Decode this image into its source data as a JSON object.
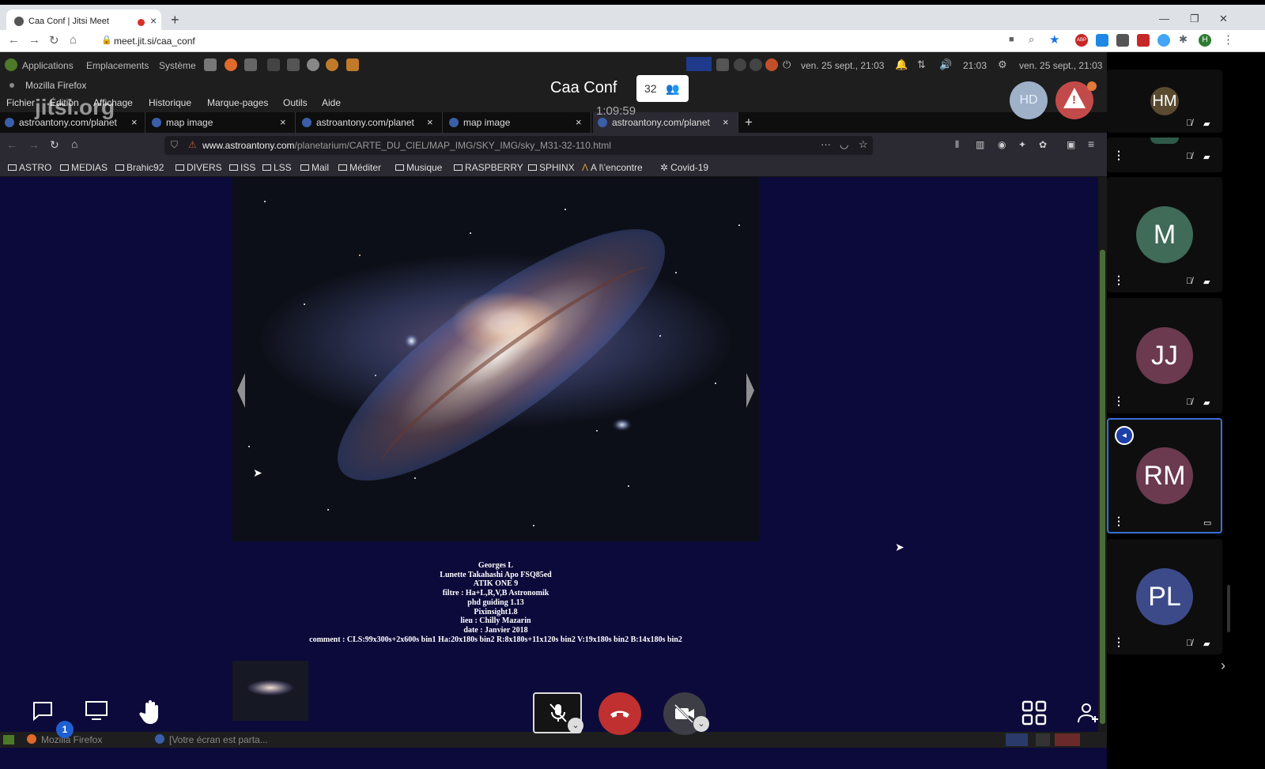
{
  "chrome": {
    "tab_title": "Caa Conf | Jitsi Meet",
    "url": "meet.jit.si/caa_conf",
    "profile_initial": "H",
    "abp_badge": "ABP"
  },
  "desktop": {
    "menus": [
      "Applications",
      "Emplacements",
      "Système"
    ],
    "clock_left": "ven. 25 sept., 21:03",
    "clock_time": "21:03",
    "clock_right": "ven. 25 sept., 21:03"
  },
  "firefox": {
    "window_title": "Mozilla Firefox",
    "menu": [
      "Fichier",
      "Édition",
      "Affichage",
      "Historique",
      "Marque-pages",
      "Outils",
      "Aide"
    ],
    "tabs": [
      "astroantony.com/planet",
      "map image",
      "astroantony.com/planet",
      "map image",
      "astroantony.com/planet"
    ],
    "url_host": "www.astroantony.com",
    "url_path": "/planetarium/CARTE_DU_CIEL/MAP_IMG/SKY_IMG/sky_M31-32-110.html",
    "bookmarks": [
      "ASTRO",
      "MEDIAS",
      "Brahic92",
      "DIVERS",
      "ISS",
      "LSS",
      "Mail",
      "Méditer",
      "Musique",
      "RASPBERRY",
      "SPHINX",
      "A l\\'encontre",
      "Covid-19"
    ],
    "caption": [
      "Georges L",
      "Lunette Takahashi Apo FSQ85ed",
      "ATIK ONE 9",
      "filtre : Ha+L,R,V,B Astronomik",
      "phd guiding 1.13",
      "Pixinsight1.8",
      "lieu : Chilly Mazarin",
      "date : Janvier 2018",
      "comment : CLS:99x300s+2x600s bin1 Ha:20x180s bin2 R:8x180s+11x120s bin2 V:19x180s bin2 B:14x180s bin2"
    ],
    "taskbar": [
      "Mozilla Firefox",
      "[Votre écran est parta..."
    ]
  },
  "jitsi": {
    "conference_name": "Caa Conf",
    "participant_count": "32",
    "timer": "1:09:59",
    "watermark": "jitsi.org",
    "local_initials": "HD",
    "chat_badge": "1"
  },
  "participants": [
    {
      "initials": "HM",
      "color": "#5a4a2f"
    },
    {
      "initials": "",
      "color": "#2f5a4a"
    },
    {
      "initials": "M",
      "color": "#3f6b58"
    },
    {
      "initials": "JJ",
      "color": "#6b3a4f"
    },
    {
      "initials": "RM",
      "color": "#6b3a4f"
    },
    {
      "initials": "PL",
      "color": "#3d4a8a"
    }
  ]
}
